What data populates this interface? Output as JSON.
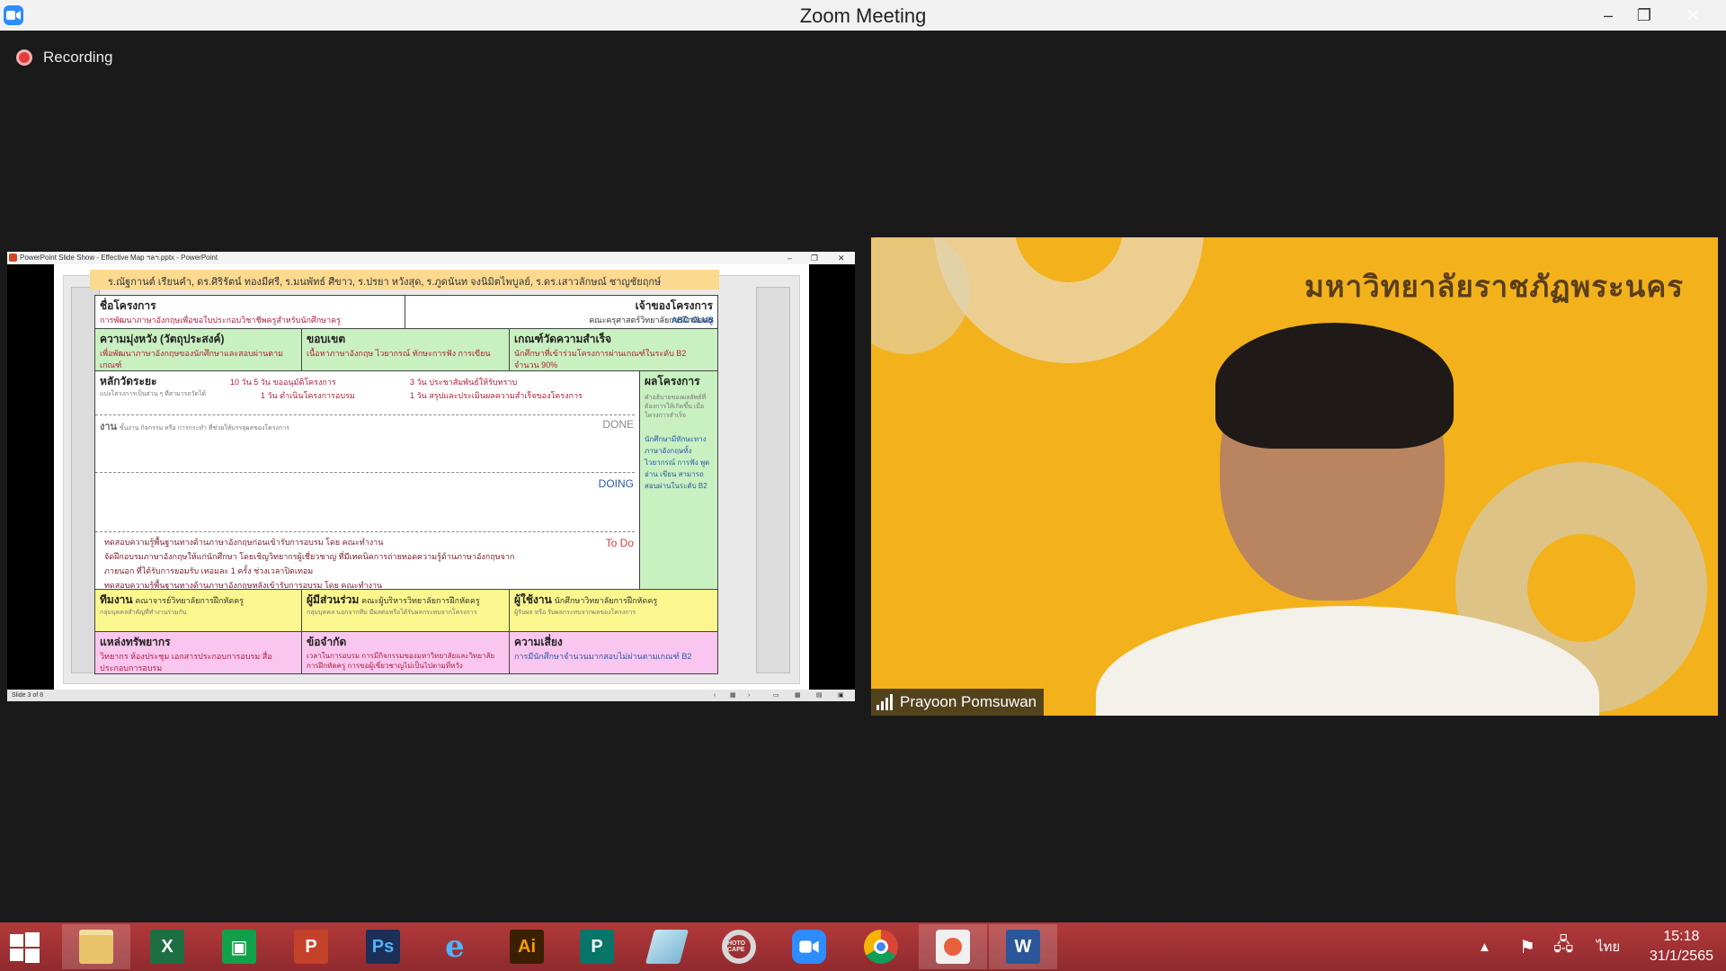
{
  "window": {
    "title": "Zoom Meeting",
    "minimize_glyph": "–",
    "restore_glyph": "❐",
    "close_glyph": "✕"
  },
  "recording": {
    "label": "Recording"
  },
  "shared_screen": {
    "pp_title": "PowerPoint Slide Show - Effective Map ฯลฯ.pptx - PowerPoint",
    "pp_status": "Slide 3 of 8",
    "slide": {
      "authors": "ร.ณัฐกานต์ เรียนคำ, ดร.ศิริรัตน์ ทองมีศรี, ร.มนพัทธ์ ศีขาว, ร.ปรยา หวังสุด, ร.ภูดนันท จงนิมิตไพบูลย์, ร.ดร.เสาวลักษณ์ ชาญชัยฤกษ์",
      "project_name_h": "ชื่อโครงการ",
      "project_name_t": "การพัฒนาภาษาอังกฤษเพื่อขอใบประกอบวิชาชีพครูสำหรับนักศึกษาครู",
      "owner_h": "เจ้าของโครงการ",
      "owner_t": "คณะครุศาสตร์วิทยาลัยการฝึกหัดครู",
      "owner_logo": "ABC CLUB",
      "goal_h": "ความมุ่งหวัง (วัตถุประสงค์)",
      "goal_t": "เพื่อพัฒนาภาษาอังกฤษของนักศึกษาและสอบผ่านตามเกณฑ์",
      "scope_h": "ขอบเขต",
      "scope_t": "เนื้อหาภาษาอังกฤษ ไวยากรณ์ ทักษะการฟัง การเขียน",
      "criteria_h": "เกณฑ์วัดความสำเร็จ",
      "criteria_t": "นักศึกษาที่เข้าร่วมโครงการผ่านเกณฑ์ในระดับ B2 จำนวน 90%",
      "milestone_h": "หลักวัดระยะ",
      "milestone_g": "แบ่งโครงการเป็นส่วน ๆ ที่สามารถวัดได้",
      "milestone_1": "10 วัน  5 วัน ขออนุมัติโครงการ",
      "milestone_2": "1 วัน ดำเนินโครงการอบรม",
      "milestone_3": "3 วัน ประชาสัมพันธ์ให้รับทราบ",
      "milestone_4": "1 วัน สรุปและประเมินผลความสำเร็จของโครงการ",
      "result_h": "ผลโครงการ",
      "result_g": "คำอธิบายของผลลัพธ์ที่ต้องการให้เกิดขึ้น เมื่อโครงการสำเร็จ",
      "result_t": "นักศึกษามีทักษะทางภาษาอังกฤษทั้งไวยากรณ์ การฟัง พูด อ่าน เขียน สามารถสอบผ่านในระดับ B2",
      "work_h": "งาน",
      "work_g": "ขั้นงาน กิจกรรม หรือ การกระทำ ที่ช่วยให้บรรลุผลของโครงการ",
      "lane_done": "DONE",
      "lane_doing": "DOING",
      "lane_todo": "To Do",
      "todo_1": "ทดสอบความรู้พื้นฐานทางด้านภาษาอังกฤษก่อนเข้ารับการอบรม โดย คณะทำงาน",
      "todo_2": "จัดฝึกอบรมภาษาอังกฤษให้แก่นักศึกษา โดยเชิญวิทยากรผู้เชี่ยวชาญ ที่มีเทคนิคการถ่ายทอดความรู้ด้านภาษาอังกฤษจาก",
      "todo_3": "ภายนอก ที่ได้รับการยอมรับ เทอมละ 1 ครั้ง ช่วงเวลาปิดเทอม",
      "todo_4": "ทดสอบความรู้พื้นฐานทางด้านภาษาอังกฤษหลังเข้ารับการอบรม โดย คณะทำงาน",
      "team_h": "ทีมงาน",
      "team_t": "คณาจารย์วิทยาลัยการฝึกหัดครู",
      "team_g": "กลุ่มบุคคลสำคัญที่ทำงานร่วมกัน",
      "stake_h": "ผู้มีส่วนร่วม",
      "stake_t": "คณะผู้บริหารวิทยาลัยการฝึกหัดครู",
      "stake_g": "กลุ่มบุคคล นอกจากทีม มีผลต่อหรือได้รับผลกระทบจากโครงการ",
      "user_h": "ผู้ใช้งาน",
      "user_t": "นักศึกษาวิทยาลัยการฝึกหัดครู",
      "user_g": "ผู้รับผล หรือ รับผลกระทบจากผลของโครงการ",
      "resource_h": "แหล่งทรัพยากร",
      "resource_t": "วิทยากร ห้องประชุม เอกสารประกอบการอบรม สื่อประกอบการอบรม",
      "constraint_h": "ข้อจำกัด",
      "constraint_t": "เวลาในการอบรม การมีกิจกรรมของมหาวิทยาลัยและวิทยาลัยการฝึกหัดครู การขอผู้เชี่ยวชาญไม่เป็นไปตามที่หวัง",
      "risk_h": "ความเสี่ยง",
      "risk_t": "การมีนักศึกษาจำนวนมากสอบไม่ผ่านตามเกณฑ์ B2"
    }
  },
  "video": {
    "background_text": "มหาวิทยาลัยราชภัฏพระนคร",
    "participant_name": "Prayoon Pomsuwan"
  },
  "taskbar": {
    "apps": [
      {
        "name": "windows-explorer",
        "label": ""
      },
      {
        "name": "excel",
        "label": "X"
      },
      {
        "name": "publisher-green",
        "label": "▣"
      },
      {
        "name": "powerpoint",
        "label": "P"
      },
      {
        "name": "photoshop",
        "label": "Ps"
      },
      {
        "name": "internet-explorer",
        "label": "e"
      },
      {
        "name": "illustrator",
        "label": "Ai"
      },
      {
        "name": "publisher",
        "label": "P"
      },
      {
        "name": "notepad-pen",
        "label": ""
      },
      {
        "name": "hoto-cape",
        "label": "HOTO CAPE"
      },
      {
        "name": "zoom",
        "label": ""
      },
      {
        "name": "chrome",
        "label": ""
      },
      {
        "name": "presentation",
        "label": ""
      },
      {
        "name": "word",
        "label": "W"
      }
    ],
    "lang": "ไทย",
    "time": "15:18",
    "date": "31/1/2565",
    "colors": {
      "taskbar": "#a3333a",
      "zoom": "#2d8cff"
    }
  }
}
